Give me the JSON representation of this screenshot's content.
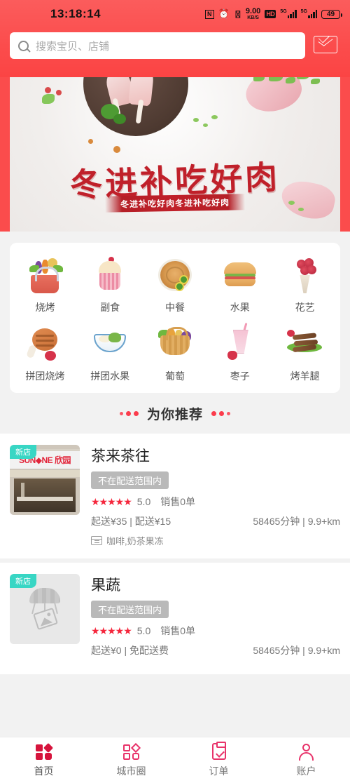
{
  "status_bar": {
    "time": "13:18:14",
    "nfc": "N",
    "alarm_icon": "alarm-icon",
    "vibrate_icon": "vibrate-icon",
    "network_speed_value": "9.00",
    "network_speed_unit": "KB/S",
    "hd_label": "HD",
    "signal_1_label": "5G",
    "signal_2_label": "5G",
    "battery": "49"
  },
  "search": {
    "placeholder": "搜索宝贝、店铺",
    "icon": "search-icon",
    "mail_icon": "envelope-icon"
  },
  "banner": {
    "title": "冬进补吃好肉",
    "subtitle": "冬进补吃好肉冬进补吃好肉"
  },
  "categories": [
    {
      "label": "烧烤",
      "icon": "grocery-basket-icon"
    },
    {
      "label": "副食",
      "icon": "cupcake-icon"
    },
    {
      "label": "中餐",
      "icon": "pancake-icon"
    },
    {
      "label": "水果",
      "icon": "burger-icon"
    },
    {
      "label": "花艺",
      "icon": "bouquet-icon"
    },
    {
      "label": "拼团烧烤",
      "icon": "grilled-meat-icon"
    },
    {
      "label": "拼团水果",
      "icon": "noodle-bowl-icon"
    },
    {
      "label": "葡萄",
      "icon": "fruit-basket-icon"
    },
    {
      "label": "枣子",
      "icon": "smoothie-icon"
    },
    {
      "label": "烤羊腿",
      "icon": "skewers-icon"
    }
  ],
  "section": {
    "title": "为你推荐"
  },
  "shops": [
    {
      "name": "茶来茶往",
      "badge": "新店",
      "status": "不在配送范围内",
      "rating": "5.0",
      "stars": "★★★★★",
      "sales": "销售0单",
      "delivery": "起送¥35 | 配送¥15",
      "distance": "58465分钟 | 9.9+km",
      "tags": "咖啡,奶茶果冻",
      "sign_text": "SUN◆NE 欣园",
      "image_type": "storefront-photo"
    },
    {
      "name": "果蔬",
      "badge": "新店",
      "status": "不在配送范围内",
      "rating": "5.0",
      "stars": "★★★★★",
      "sales": "销售0单",
      "delivery": "起送¥0 | 免配送费",
      "distance": "58465分钟 | 9.9+km",
      "tags": "",
      "image_type": "placeholder-image"
    }
  ],
  "tabbar": [
    {
      "label": "首页",
      "icon": "home-icon",
      "active": true
    },
    {
      "label": "城市圈",
      "icon": "city-circle-icon",
      "active": false
    },
    {
      "label": "订单",
      "icon": "order-clipboard-icon",
      "active": false
    },
    {
      "label": "账户",
      "icon": "account-person-icon",
      "active": false
    }
  ],
  "colors": {
    "brand_red": "#fb4c4c",
    "accent_red": "#d6143c",
    "badge_teal": "#38d6c4",
    "status_gray": "#b9b9b9",
    "page_bg": "#f2f2f2"
  }
}
